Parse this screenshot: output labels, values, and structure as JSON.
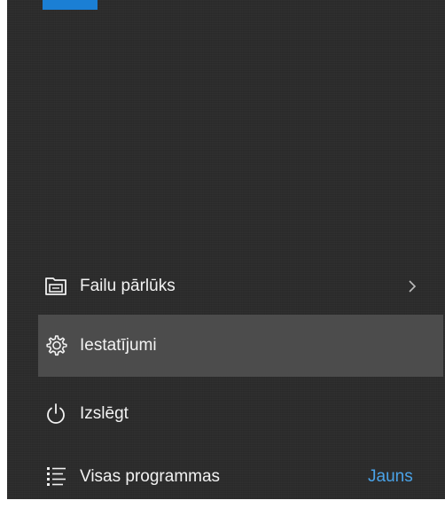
{
  "colors": {
    "panel_background": "#2b2b2b",
    "selected_background": "#4c4c4c",
    "accent": "#1b7fd4",
    "new_badge": "#4aa3e8",
    "text": "#f2f2f2"
  },
  "menu": {
    "items": [
      {
        "label": "Failu pārlūks",
        "icon": "file-explorer-icon",
        "has_submenu": true
      },
      {
        "label": "Iestatījumi",
        "icon": "settings-gear-icon",
        "selected": true
      },
      {
        "label": "Izslēgt",
        "icon": "power-icon"
      },
      {
        "label": "Visas programmas",
        "icon": "all-apps-list-icon",
        "badge": "Jauns"
      }
    ]
  }
}
